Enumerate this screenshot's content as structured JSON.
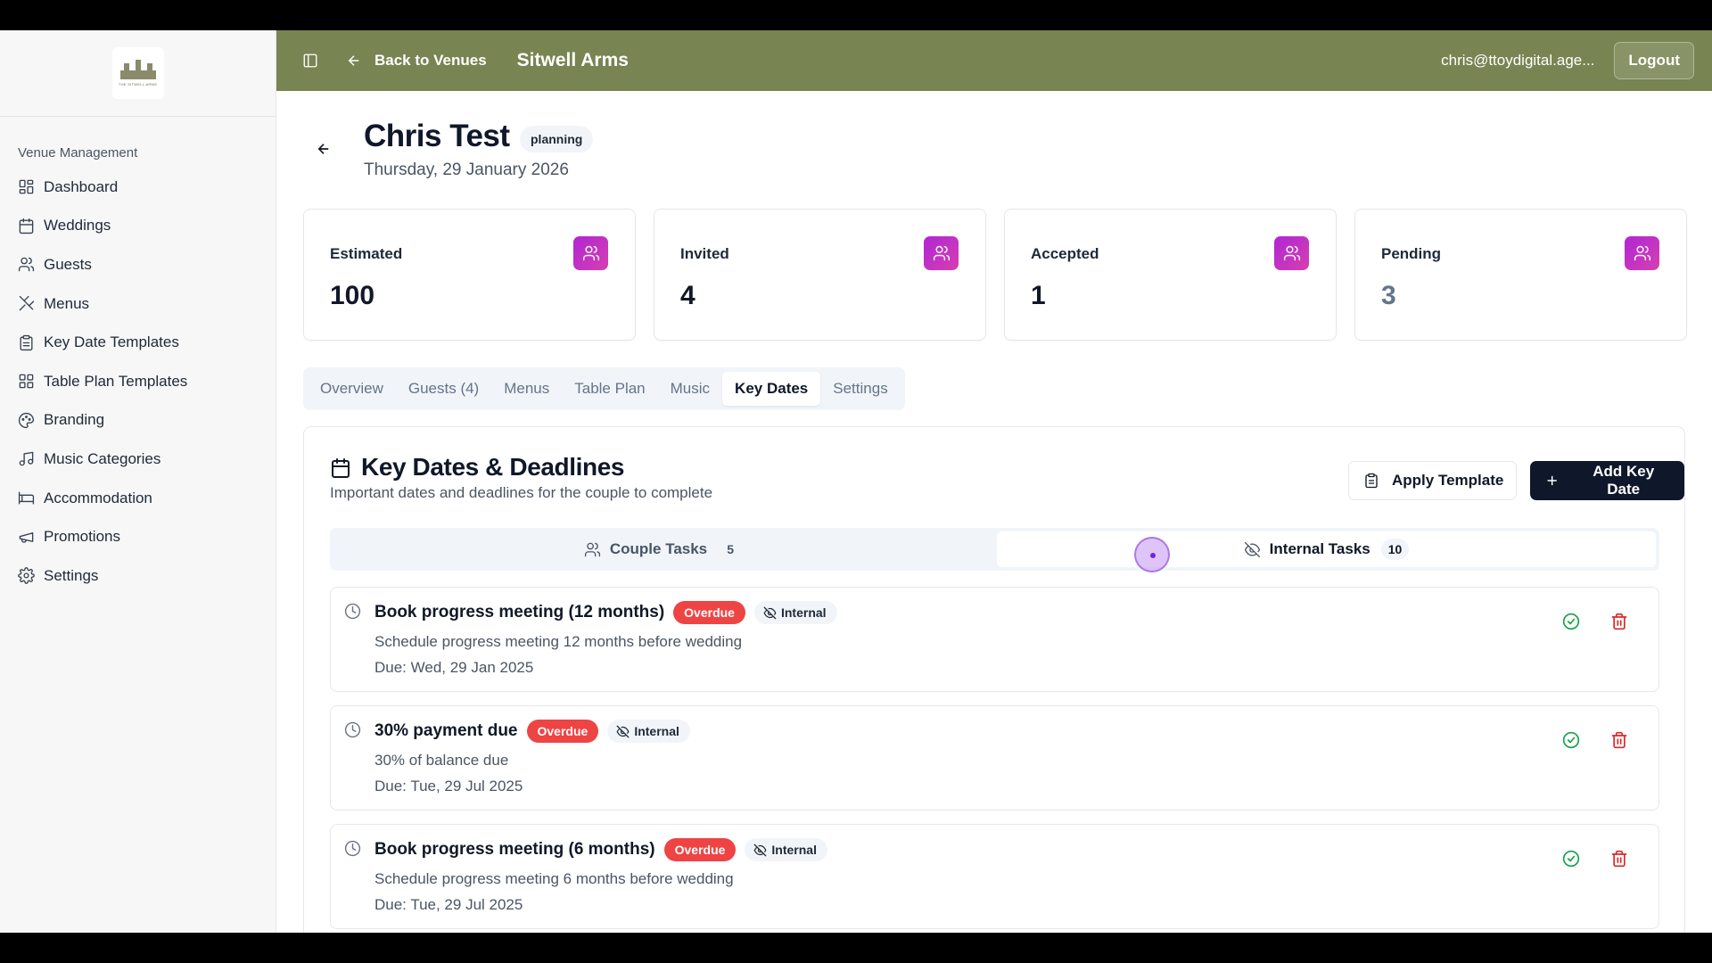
{
  "sidebar": {
    "section_label": "Venue Management",
    "items": [
      {
        "label": "Dashboard",
        "icon": "grid-icon"
      },
      {
        "label": "Weddings",
        "icon": "calendar-icon"
      },
      {
        "label": "Guests",
        "icon": "users-icon"
      },
      {
        "label": "Menus",
        "icon": "utensils-icon"
      },
      {
        "label": "Key Date Templates",
        "icon": "clipboard-icon"
      },
      {
        "label": "Table Plan Templates",
        "icon": "grid-icon"
      },
      {
        "label": "Branding",
        "icon": "palette-icon"
      },
      {
        "label": "Music Categories",
        "icon": "music-icon"
      },
      {
        "label": "Accommodation",
        "icon": "bed-icon"
      },
      {
        "label": "Promotions",
        "icon": "megaphone-icon"
      },
      {
        "label": "Settings",
        "icon": "gear-icon"
      }
    ]
  },
  "header": {
    "back_label": "Back to Venues",
    "venue_name": "Sitwell Arms",
    "user_email": "chris@ttoydigital.age...",
    "logout_label": "Logout",
    "bg_color": "#788452"
  },
  "wedding": {
    "name": "Chris Test",
    "status": "planning",
    "date": "Thursday, 29 January 2026"
  },
  "stats": [
    {
      "label": "Estimated",
      "value": "100"
    },
    {
      "label": "Invited",
      "value": "4"
    },
    {
      "label": "Accepted",
      "value": "1"
    },
    {
      "label": "Pending",
      "value": "3"
    }
  ],
  "tabs": [
    {
      "label": "Overview"
    },
    {
      "label": "Guests (4)"
    },
    {
      "label": "Menus"
    },
    {
      "label": "Table Plan"
    },
    {
      "label": "Music"
    },
    {
      "label": "Key Dates",
      "active": true
    },
    {
      "label": "Settings"
    }
  ],
  "key_dates": {
    "title": "Key Dates & Deadlines",
    "subtitle": "Important dates and deadlines for the couple to complete",
    "apply_template_label": "Apply Template",
    "add_key_date_label": "Add Key Date",
    "segments": {
      "couple": {
        "label": "Couple Tasks",
        "count": "5"
      },
      "internal": {
        "label": "Internal Tasks",
        "count": "10",
        "selected": true
      }
    },
    "tasks": [
      {
        "title": "Book progress meeting (12 months)",
        "overdue_label": "Overdue",
        "internal_label": "Internal",
        "description": "Schedule progress meeting 12 months before wedding",
        "due": "Due: Wed, 29 Jan 2025"
      },
      {
        "title": "30% payment due",
        "overdue_label": "Overdue",
        "internal_label": "Internal",
        "description": "30% of balance due",
        "due": "Due: Tue, 29 Jul 2025"
      },
      {
        "title": "Book progress meeting (6 months)",
        "overdue_label": "Overdue",
        "internal_label": "Internal",
        "description": "Schedule progress meeting 6 months before wedding",
        "due": "Due: Tue, 29 Jul 2025"
      }
    ]
  },
  "colors": {
    "accent_gradient_start": "#b026d4",
    "accent_gradient_end": "#d63fb0",
    "overdue": "#ef4444",
    "complete": "#16a34a",
    "delete": "#dc2626",
    "primary_button": "#0f172a"
  }
}
